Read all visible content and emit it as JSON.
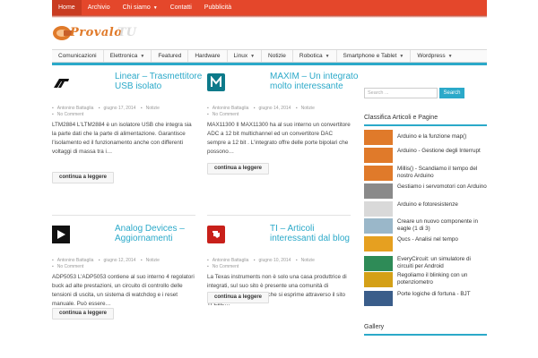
{
  "top_nav": [
    {
      "label": "Home",
      "dropdown": false,
      "active": true
    },
    {
      "label": "Archivio",
      "dropdown": false,
      "active": false
    },
    {
      "label": "Chi siamo",
      "dropdown": true,
      "active": false
    },
    {
      "label": "Contatti",
      "dropdown": false,
      "active": false
    },
    {
      "label": "Pubblicità",
      "dropdown": false,
      "active": false
    }
  ],
  "logo": {
    "part1": "Provalo",
    "part2": "TU"
  },
  "category_nav": [
    {
      "label": "Comunicazioni",
      "dropdown": false
    },
    {
      "label": "Elettronica",
      "dropdown": true
    },
    {
      "label": "Featured",
      "dropdown": false
    },
    {
      "label": "Hardware",
      "dropdown": false
    },
    {
      "label": "Linux",
      "dropdown": true
    },
    {
      "label": "Notizie",
      "dropdown": false
    },
    {
      "label": "Robotica",
      "dropdown": true
    },
    {
      "label": "Smartphone e Tablet",
      "dropdown": true
    },
    {
      "label": "Wordpress",
      "dropdown": true
    }
  ],
  "articles": [
    {
      "title": "Linear – Trasmettitore USB isolato",
      "author": "Antonino Battaglia",
      "date": "giugno 17, 2014",
      "category": "Notizie",
      "comments": "No Comment",
      "excerpt": "LTM2884 L'LTM2884 è un isolatore USB che integra sia la parte dati che la parte di alimentazione. Garantisce l'isolamento ed il funzionamento anche con differenti voltaggi di massa tra i…",
      "more": "continua a leggere",
      "logo": "linear-logo"
    },
    {
      "title": "MAXIM – Un integrato molto interessante",
      "author": "Antonino Battaglia",
      "date": "giugno 14, 2014",
      "category": "Notizie",
      "comments": "No Comment",
      "excerpt": "MAX11300 Il MAX11300 ha al suo interno un convertitore ADC a 12 bit multichannel ed un convertitore DAC sempre a 12 bit . L'integrato offre delle porte bipolari che possono…",
      "more": "continua a leggere",
      "logo": "maxim-logo"
    },
    {
      "title": "Analog Devices – Aggiornamenti",
      "author": "Antonino Battaglia",
      "date": "giugno 12, 2014",
      "category": "Notizie",
      "comments": "No Comment",
      "excerpt": "ADP5053 L'ADP5053 contiene al suo interno 4 regolatori buck ad alte prestazioni, un circuito di controllo delle tensioni di uscita, un sistema di watchdog e i reset manuale. Può essere…",
      "more": "continua a leggere",
      "logo": "analog-devices-logo"
    },
    {
      "title": "TI – Articoli interessanti dal blog",
      "author": "Antonino Battaglia",
      "date": "giugno 10, 2014",
      "category": "Notizie",
      "comments": "No Comment",
      "excerpt": "La Texas instruments non è solo una casa produttrice di integrati, sul suo sito è presente una comunità di sviluppatori molto attiva che si esprime attraverso il sito TI E2E…",
      "more": "continua a leggere",
      "logo": "ti-logo"
    }
  ],
  "sidebar": {
    "search_placeholder": "Search ...",
    "search_button": "Search",
    "popular_title": "Classifica Articoli e Pagine",
    "popular_items": [
      "Arduino e la funzione map()",
      "Arduino - Gestione degli Interrupt",
      "Millis() - Scandiamo il tempo del nostro Arduino",
      "Gestiamo i servomotori con Arduino",
      "Arduino e fotoresistenze",
      "Creare un nuovo componente in eagle (1 di 3)",
      "Qucs - Analisi nel tempo",
      "EveryCircuit: un simulatore di circuiti per Android",
      "Regoliamo il blinking con un potenziometro",
      "Porte logiche di fortuna - BJT"
    ],
    "gallery_title": "Gallery"
  },
  "colors": {
    "accent": "#2ba9c9",
    "topbar": "#e4472b",
    "brand_orange": "#e07a2a"
  }
}
